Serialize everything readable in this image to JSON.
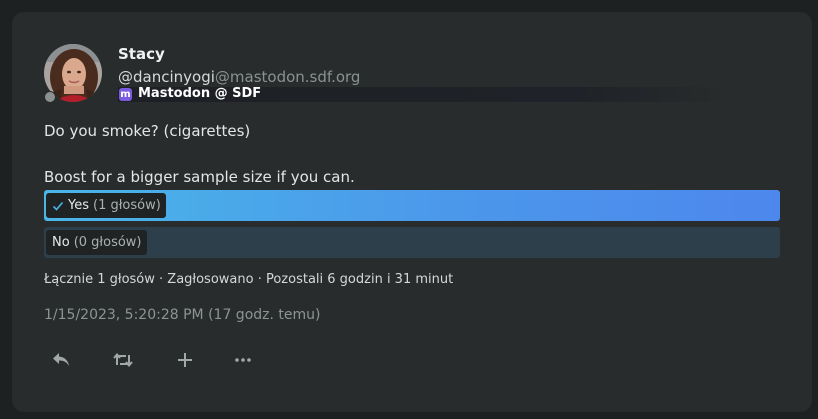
{
  "post": {
    "display_name": "Stacy",
    "handle_user": "@dancinyogi",
    "handle_domain": "@mastodon.sdf.org",
    "instance_name": "Mastodon @ SDF",
    "instance_icon": "mastodon-icon",
    "text": [
      "Do you smoke? (cigarettes)",
      "Boost for a bigger sample size if you can."
    ],
    "timestamp": "1/15/2023, 5:20:28 PM (17 godz. temu)"
  },
  "poll": {
    "options": [
      {
        "label": "Yes",
        "votes_text": "(1 głosów)",
        "selected": true,
        "share": 1.0
      },
      {
        "label": "No",
        "votes_text": "(0 głosów)",
        "selected": false,
        "share": 0.0
      }
    ],
    "footer": "Łącznie 1 głosów · Zagłosowano · Pozostali 6 godzin i 31 minut"
  },
  "actions": [
    "reply-icon",
    "boost-icon",
    "add-icon",
    "more-icon"
  ],
  "colors": {
    "card_bg": "#282c2c",
    "page_bg": "#1e2121",
    "poll_fill_start": "#4ab6e8",
    "poll_fill_end": "#4d87ec",
    "poll_empty": "#2c3f4a",
    "instance_badge": "#7a5be0"
  }
}
